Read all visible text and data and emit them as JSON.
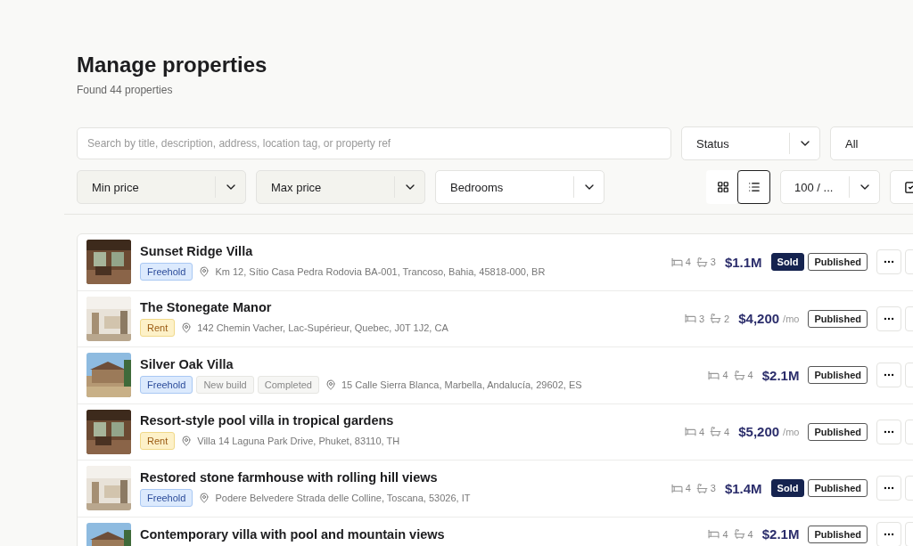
{
  "header": {
    "title": "Manage properties",
    "subtitle": "Found 44 properties"
  },
  "filters": {
    "search": {
      "placeholder": "Search by title, description, address, location tag, or property ref"
    },
    "status": {
      "value": "Status"
    },
    "status_value": {
      "value": "All"
    },
    "selects": [
      {
        "value": "Min price",
        "filled": true
      },
      {
        "value": "Max price",
        "filled": true
      },
      {
        "value": "Bedrooms",
        "filled": false
      }
    ],
    "view": [
      {
        "kind": "grid",
        "selected": false
      },
      {
        "kind": "list",
        "selected": true
      }
    ],
    "per_page": {
      "value": "100 / ..."
    }
  },
  "properties": [
    {
      "title": "Sunset Ridge Villa",
      "tags": [
        {
          "label": "Freehold",
          "kind": "freehold"
        }
      ],
      "address": "Km 12, Sítio Casa Pedra Rodovia BA-001, Trancoso, Bahia, 45818-000, BR",
      "beds": "4",
      "baths": "3",
      "price": "$1.1M",
      "badges": [
        {
          "label": "Sold",
          "kind": "sold"
        },
        {
          "label": "Published",
          "kind": "published"
        }
      ]
    },
    {
      "title": "The Stonegate Manor",
      "tags": [
        {
          "label": "Rent",
          "kind": "rent"
        }
      ],
      "address": "142 Chemin Vacher, Lac-Supérieur, Quebec, J0T 1J2, CA",
      "beds": "3",
      "baths": "2",
      "price": "$4,200",
      "period": "/mo",
      "badges": [
        {
          "label": "Published",
          "kind": "published"
        }
      ]
    },
    {
      "title": "Silver Oak Villa",
      "tags": [
        {
          "label": "Freehold",
          "kind": "freehold"
        },
        {
          "label": "New build",
          "kind": "neutral"
        },
        {
          "label": "Completed",
          "kind": "neutral"
        }
      ],
      "address": "15 Calle Sierra Blanca, Marbella, Andalucía, 29602, ES",
      "beds": "4",
      "baths": "4",
      "price": "$2.1M",
      "badges": [
        {
          "label": "Published",
          "kind": "published"
        }
      ]
    },
    {
      "title": "Resort-style pool villa in tropical gardens",
      "tags": [
        {
          "label": "Rent",
          "kind": "rent"
        }
      ],
      "address": "Villa 14 Laguna Park Drive, Phuket, 83110, TH",
      "beds": "4",
      "baths": "4",
      "price": "$5,200",
      "period": "/mo",
      "badges": [
        {
          "label": "Published",
          "kind": "published"
        }
      ]
    },
    {
      "title": "Restored stone farmhouse with rolling hill views",
      "tags": [
        {
          "label": "Freehold",
          "kind": "freehold"
        }
      ],
      "address": "Podere Belvedere Strada delle Colline, Toscana, 53026, IT",
      "beds": "4",
      "baths": "3",
      "price": "$1.4M",
      "badges": [
        {
          "label": "Sold",
          "kind": "sold"
        },
        {
          "label": "Published",
          "kind": "published"
        }
      ]
    },
    {
      "title": "Contemporary villa with pool and mountain views",
      "beds": "4",
      "baths": "4",
      "price": "$2.1M",
      "badges": [
        {
          "label": "Published",
          "kind": "published"
        }
      ]
    }
  ]
}
